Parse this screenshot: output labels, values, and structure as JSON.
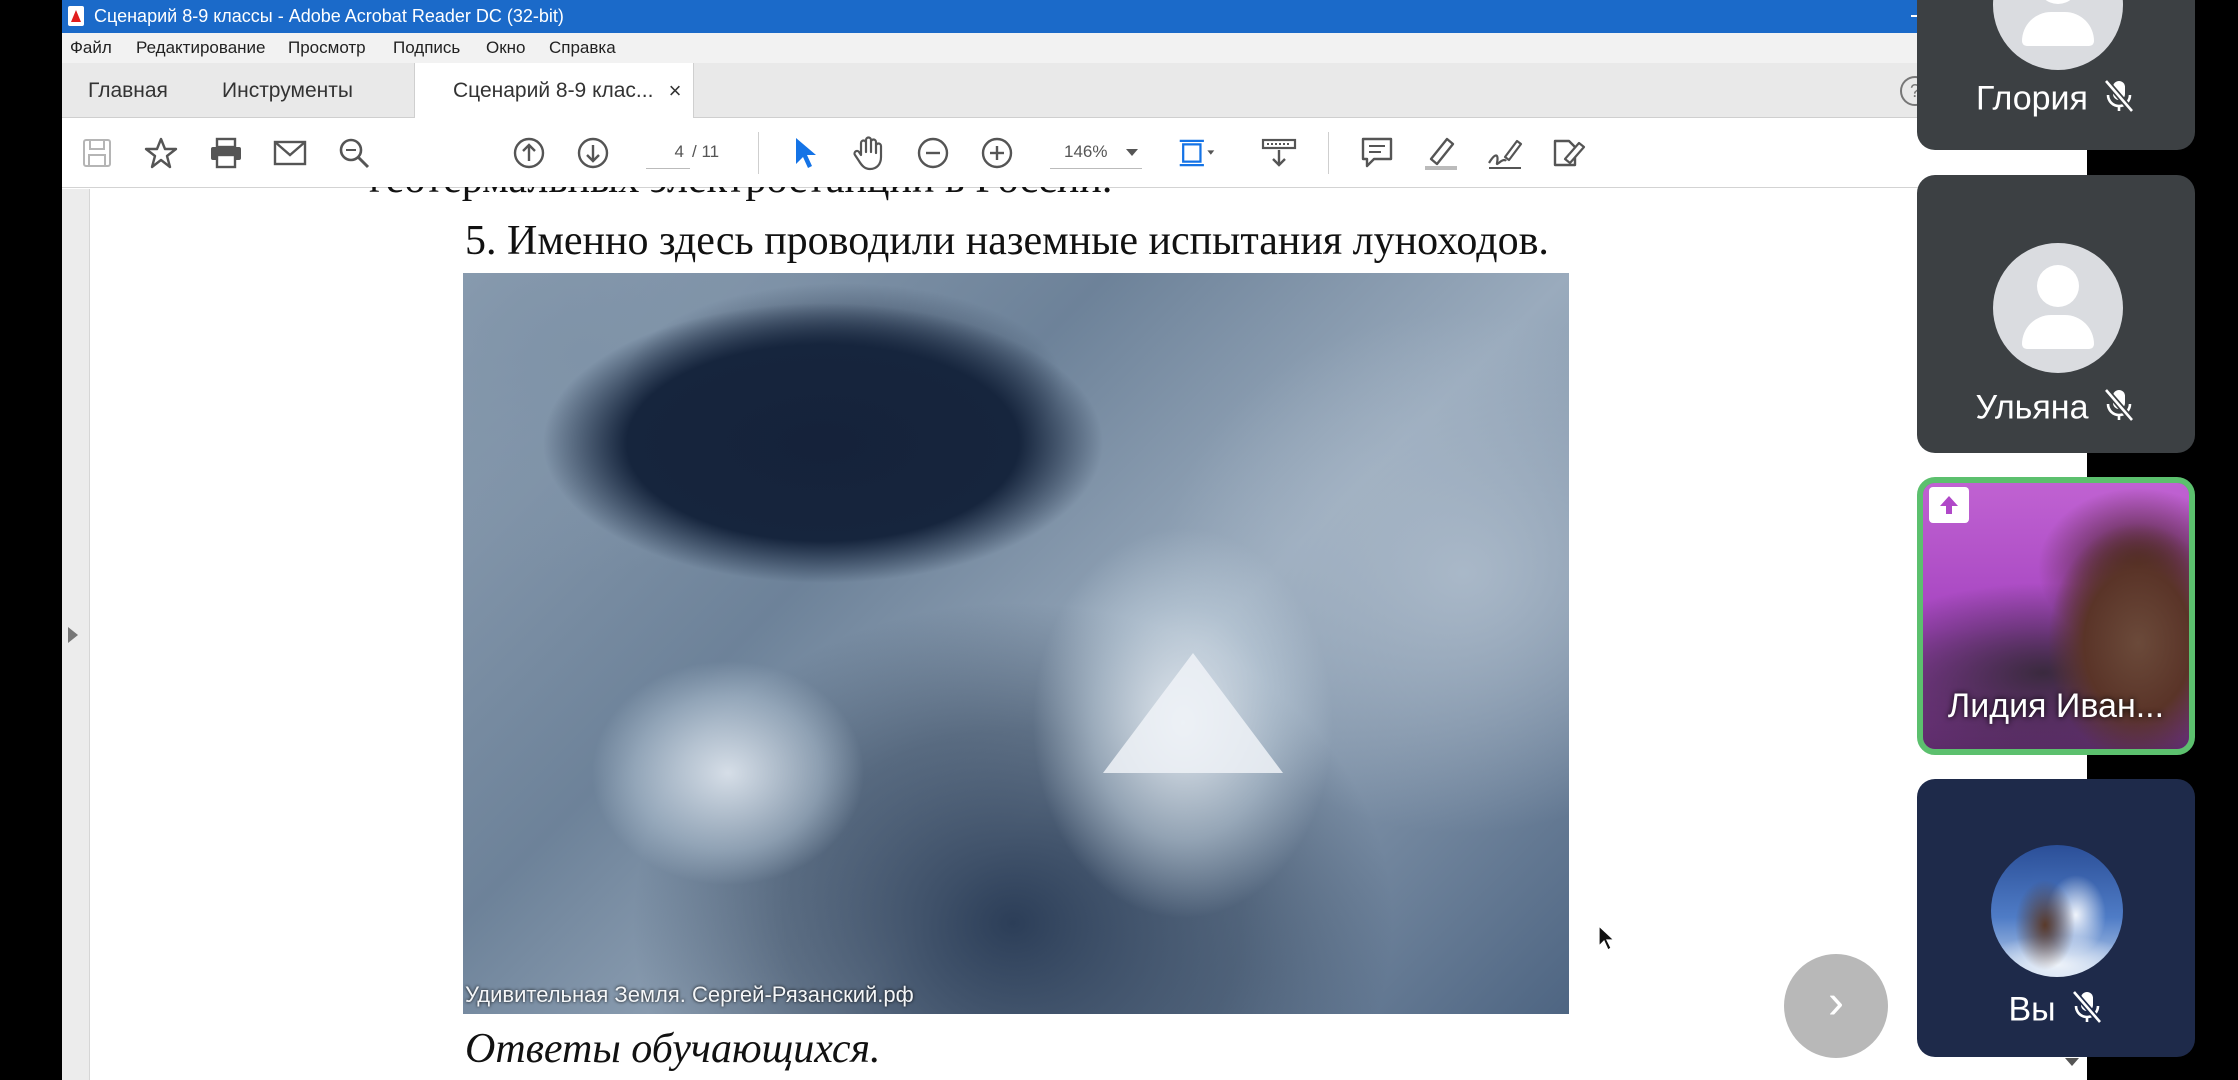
{
  "window": {
    "title": "Сценарий 8-9 классы - Adobe Acrobat Reader DC (32-bit)"
  },
  "menu": [
    "Файл",
    "Редактирование",
    "Просмотр",
    "Подпись",
    "Окно",
    "Справка"
  ],
  "tabs": {
    "home": "Главная",
    "tools": "Инструменты",
    "document": "Сценарий 8-9 клас..."
  },
  "toolbar": {
    "page_current": "4",
    "page_total": "/ 11",
    "zoom": "146%",
    "icons": [
      "save-icon",
      "bookmark-star-icon",
      "print-icon",
      "email-icon",
      "search-zoom-icon",
      "prev-page-icon",
      "next-page-icon",
      "select-cursor-icon",
      "hand-tool-icon",
      "zoom-out-icon",
      "zoom-in-icon",
      "fit-page-icon",
      "scroll-mode-icon",
      "comment-icon",
      "highlight-icon",
      "sign-icon",
      "fill-sign-icon"
    ]
  },
  "document": {
    "prev_line": "геотермальных электростанций в России.",
    "question": "5. Именно здесь проводили наземные испытания луноходов.",
    "photo_caption": "Удивительная Земля. Сергей-Рязанский.рф",
    "answers": "Ответы обучающихся."
  },
  "participants": [
    {
      "name": "Глория",
      "muted": true
    },
    {
      "name": "Ульяна",
      "muted": true
    },
    {
      "name": "Лидия Иван...",
      "presenting": true
    },
    {
      "name": "Вы",
      "muted": true
    }
  ],
  "colors": {
    "titlebar": "#1b6ac9",
    "tile_bg": "#3c4043",
    "active_border": "#5cc06e",
    "select_accent": "#1473e6"
  }
}
